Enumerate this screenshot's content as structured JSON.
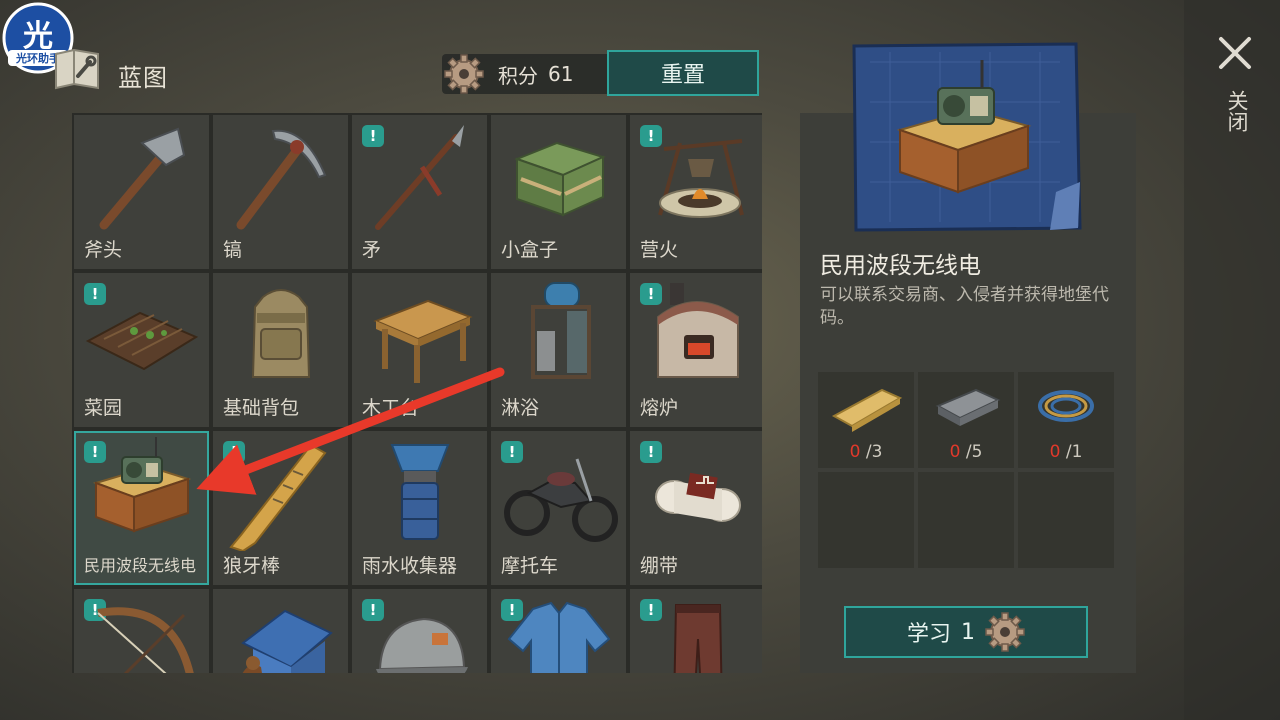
{
  "watermark": {
    "glyph": "光",
    "text": "光环助手"
  },
  "header": {
    "title": "蓝图",
    "points_label": "积分",
    "points_value": "61",
    "reset_label": "重置"
  },
  "grid": {
    "items": [
      {
        "label": "斧头",
        "icon": "axe-icon",
        "new": false
      },
      {
        "label": "镐",
        "icon": "pickaxe-icon",
        "new": false
      },
      {
        "label": "矛",
        "icon": "spear-icon",
        "new": true
      },
      {
        "label": "小盒子",
        "icon": "crate-icon",
        "new": false
      },
      {
        "label": "营火",
        "icon": "campfire-icon",
        "new": true
      },
      {
        "label": "菜园",
        "icon": "garden-icon",
        "new": true
      },
      {
        "label": "基础背包",
        "icon": "backpack-icon",
        "new": false
      },
      {
        "label": "木工台",
        "icon": "workbench-icon",
        "new": false
      },
      {
        "label": "淋浴",
        "icon": "shower-icon",
        "new": false
      },
      {
        "label": "熔炉",
        "icon": "furnace-icon",
        "new": true
      },
      {
        "label": "民用波段无线电",
        "icon": "radio-icon",
        "new": true,
        "selected": true
      },
      {
        "label": "狼牙棒",
        "icon": "spiked-club-icon",
        "new": true
      },
      {
        "label": "雨水收集器",
        "icon": "rain-collector-icon",
        "new": false
      },
      {
        "label": "摩托车",
        "icon": "motorcycle-icon",
        "new": true
      },
      {
        "label": "绷带",
        "icon": "bandage-icon",
        "new": true
      },
      {
        "label": "",
        "icon": "bow-icon",
        "new": true
      },
      {
        "label": "",
        "icon": "doghouse-icon",
        "new": false
      },
      {
        "label": "",
        "icon": "cap-icon",
        "new": true
      },
      {
        "label": "",
        "icon": "shirt-icon",
        "new": true
      },
      {
        "label": "",
        "icon": "pants-icon",
        "new": true
      }
    ]
  },
  "detail": {
    "name": "民用波段无线电",
    "description": "可以联系交易商、入侵者并获得地堡代码。",
    "requirements": [
      {
        "icon": "plank-icon",
        "have": "0",
        "need": " /3"
      },
      {
        "icon": "iron-bar-icon",
        "have": "0",
        "need": " /5"
      },
      {
        "icon": "wire-icon",
        "have": "0",
        "need": " /1"
      }
    ],
    "learn_label": "学习",
    "learn_cost": "1"
  },
  "close": {
    "label": "关闭"
  },
  "colors": {
    "accent": "#2fa59c",
    "badge": "#2a9c8e",
    "missing": "#e0392b",
    "arrow": "#e8392a"
  }
}
